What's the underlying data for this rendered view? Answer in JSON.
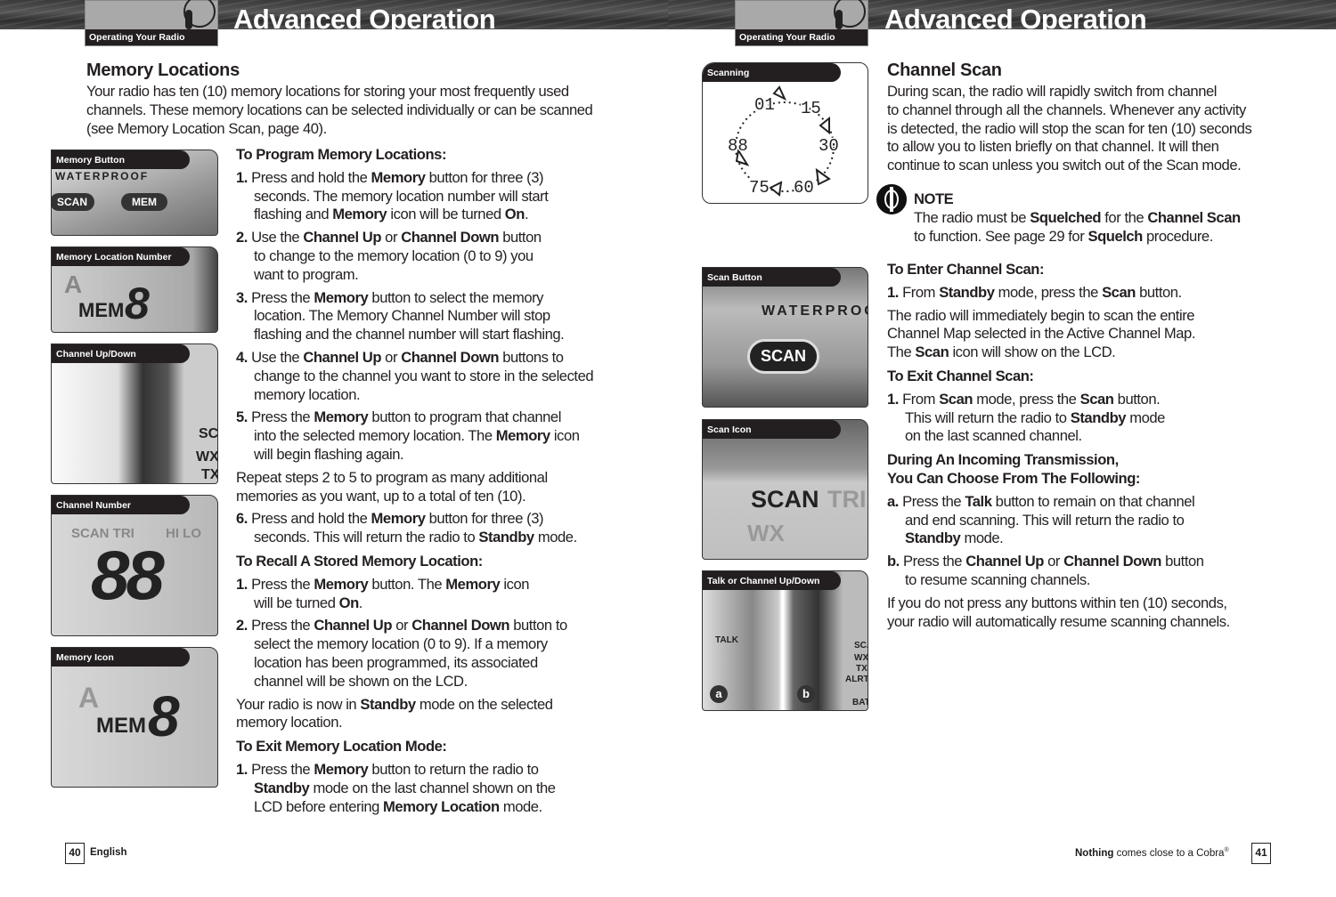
{
  "header": {
    "title": "Advanced Operation",
    "tab_label": "Operating Your Radio"
  },
  "left": {
    "section_title": "Memory Locations",
    "intro": [
      "Your radio has ten (10) memory locations for storing your most frequently used\nchannels. These memory locations can be selected individually or can be scanned\n(see Memory Location Scan, page 40)."
    ],
    "figures": [
      {
        "label": "Memory Button",
        "art": [
          "WATERPROOF",
          "SCAN",
          "MEM"
        ]
      },
      {
        "label": "Memory Location Number",
        "art": [
          "A",
          "MEM",
          "8"
        ]
      },
      {
        "label": "Channel Up/Down",
        "art": [
          "SC",
          "WX",
          "TX"
        ]
      },
      {
        "label": "Channel Number",
        "art": [
          "88",
          "SCAN TRI",
          "HI LO"
        ]
      },
      {
        "label": "Memory Icon",
        "art": [
          "MEM",
          "8",
          "A"
        ]
      }
    ],
    "blocks": [
      {
        "type": "h",
        "parts": [
          "To Program Memory Locations:"
        ]
      },
      {
        "type": "step",
        "num": "1.",
        "parts": [
          "Press and hold the ",
          {
            "b": "Memory"
          },
          " button for three (3)\nseconds. The memory location number will start\nflashing and ",
          {
            "b": "Memory"
          },
          " icon will be turned ",
          {
            "b": "On"
          },
          "."
        ]
      },
      {
        "type": "step",
        "num": "2.",
        "parts": [
          "Use the ",
          {
            "b": "Channel Up"
          },
          " or ",
          {
            "b": "Channel Down"
          },
          " button\nto change to the memory location (0 to 9) you\nwant to program."
        ]
      },
      {
        "type": "step",
        "num": "3.",
        "parts": [
          "Press the ",
          {
            "b": "Memory"
          },
          " button to select the memory\nlocation. The Memory Channel Number will stop\nflashing and the channel number will start flashing."
        ]
      },
      {
        "type": "step",
        "num": "4.",
        "parts": [
          "Use the ",
          {
            "b": "Channel Up"
          },
          " or ",
          {
            "b": "Channel Down"
          },
          " buttons to\nchange to the channel you want to store in the selected\nmemory location."
        ]
      },
      {
        "type": "step",
        "num": "5.",
        "parts": [
          "Press the ",
          {
            "b": "Memory"
          },
          " button to program that channel\ninto the selected memory location. The ",
          {
            "b": "Memory"
          },
          " icon\nwill begin flashing again."
        ]
      },
      {
        "type": "p",
        "parts": [
          "Repeat steps 2 to 5 to program as many additional\nmemories as you want, up to a total of ten (10)."
        ]
      },
      {
        "type": "step",
        "num": "6.",
        "parts": [
          "Press and hold the ",
          {
            "b": "Memory"
          },
          " button for three (3)\nseconds. This will return the radio to ",
          {
            "b": "Standby"
          },
          " mode."
        ]
      },
      {
        "type": "h",
        "parts": [
          "To Recall A Stored Memory Location:"
        ]
      },
      {
        "type": "step",
        "num": "1.",
        "parts": [
          "Press the ",
          {
            "b": "Memory"
          },
          " button. The ",
          {
            "b": "Memory"
          },
          " icon\nwill be turned ",
          {
            "b": "On"
          },
          "."
        ]
      },
      {
        "type": "step",
        "num": "2.",
        "parts": [
          "Press the ",
          {
            "b": "Channel Up"
          },
          " or ",
          {
            "b": "Channel Down"
          },
          " button to\nselect the memory location (0 to 9). If a memory\nlocation has been programmed, its associated\nchannel will be shown on the LCD."
        ]
      },
      {
        "type": "p",
        "parts": [
          "Your radio is now in ",
          {
            "b": "Standby"
          },
          " mode on the selected\nmemory location."
        ]
      },
      {
        "type": "h",
        "parts": [
          "To Exit Memory Location Mode:"
        ]
      },
      {
        "type": "step",
        "num": "1.",
        "parts": [
          "Press the ",
          {
            "b": "Memory"
          },
          " button to return the radio to\n",
          {
            "b": "Standby"
          },
          " mode on the last channel shown on the\nLCD before entering ",
          {
            "b": "Memory Location"
          },
          " mode."
        ]
      }
    ],
    "footer": {
      "page": "40",
      "language": "English"
    }
  },
  "right": {
    "section_title": "Channel Scan",
    "intro": [
      "During scan, the radio will rapidly switch from channel\nto channel through all the channels. Whenever any activity\nis detected, the radio will stop the scan for ten (10) seconds\nto allow you to listen briefly on that channel. It will then\ncontinue to scan unless you switch out of the Scan mode."
    ],
    "note": {
      "icon": "info-icon",
      "title": "NOTE",
      "parts": [
        "The radio must be ",
        {
          "b": "Squelched"
        },
        " for the ",
        {
          "b": "Channel Scan"
        },
        "\nto function. See page 29 for ",
        {
          "b": "Squelch"
        },
        " procedure."
      ]
    },
    "scan_diagram": {
      "label": "Scanning",
      "channels": [
        "01",
        "15",
        "30",
        "60",
        "75",
        "88"
      ]
    },
    "figures": [
      {
        "label": "Scan Button",
        "art": [
          "WATERPROOF",
          "SCAN"
        ]
      },
      {
        "label": "Scan Icon",
        "art": [
          "SCAN",
          "TRI",
          "WX"
        ]
      },
      {
        "label": "Talk or Channel Up/Down",
        "art": [
          "TALK",
          "a",
          "b",
          "SCA",
          "WX",
          "TX",
          "ALRT",
          "BAT"
        ]
      }
    ],
    "blocks": [
      {
        "type": "h",
        "parts": [
          "To Enter Channel Scan:"
        ]
      },
      {
        "type": "step",
        "num": "1.",
        "parts": [
          "From ",
          {
            "b": "Standby"
          },
          " mode, press the ",
          {
            "b": "Scan"
          },
          " button."
        ]
      },
      {
        "type": "p",
        "parts": [
          "The radio will immediately begin to scan the entire\nChannel Map selected in the Active Channel Map.\nThe ",
          {
            "b": "Scan"
          },
          " icon will show on the LCD."
        ]
      },
      {
        "type": "h",
        "parts": [
          "To Exit Channel Scan:"
        ]
      },
      {
        "type": "step",
        "num": "1.",
        "parts": [
          "From ",
          {
            "b": "Scan"
          },
          " mode, press the ",
          {
            "b": "Scan"
          },
          " button.\nThis will return the radio to ",
          {
            "b": "Standby"
          },
          " mode\non the last scanned channel."
        ]
      },
      {
        "type": "h",
        "parts": [
          "During An Incoming Transmission,\nYou Can Choose From The Following:"
        ]
      },
      {
        "type": "step",
        "num": "a.",
        "parts": [
          "Press the ",
          {
            "b": "Talk"
          },
          " button to remain on that channel\nand end scanning. This will return the radio to\n",
          {
            "b": "Standby"
          },
          " mode."
        ]
      },
      {
        "type": "step",
        "num": "b.",
        "parts": [
          "Press the ",
          {
            "b": "Channel Up"
          },
          " or ",
          {
            "b": "Channel Down"
          },
          " button\nto resume scanning channels."
        ]
      },
      {
        "type": "p",
        "parts": [
          "If you do not press any buttons within ten (10) seconds,\nyour radio will automatically resume scanning channels."
        ]
      }
    ],
    "footer": {
      "page": "41",
      "slogan_bold": "Nothing",
      "slogan_rest": " comes close to a Cobra",
      "reg": "®"
    }
  }
}
